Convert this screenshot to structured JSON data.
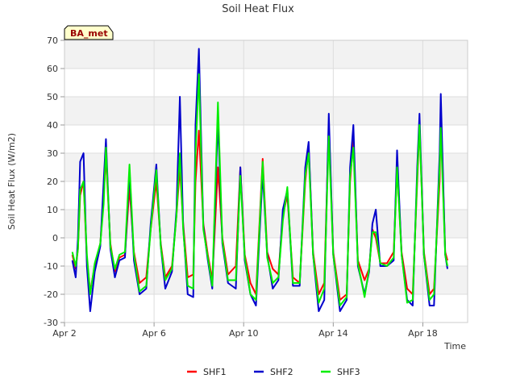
{
  "chart_data": {
    "type": "line",
    "title": "Soil Heat Flux",
    "badge": "BA_met",
    "xlabel": "Time",
    "ylabel": "Soil Heat Flux (W/m2)",
    "ylim": [
      -30,
      70
    ],
    "yticks": [
      -30,
      -20,
      -10,
      0,
      10,
      20,
      30,
      40,
      50,
      60,
      70
    ],
    "xlim": [
      2.0,
      20.0
    ],
    "xticks": [
      {
        "value": 2,
        "label": "Apr 2"
      },
      {
        "value": 6,
        "label": "Apr 6"
      },
      {
        "value": 10,
        "label": "Apr 10"
      },
      {
        "value": 14,
        "label": "Apr 14"
      },
      {
        "value": 18,
        "label": "Apr 18"
      }
    ],
    "grid": true,
    "legend_position": "bottom-center",
    "colors": {
      "SHF1": "#ff0000",
      "SHF2": "#0000cc",
      "SHF3": "#00ee00"
    },
    "series": [
      {
        "name": "SHF1",
        "color": "#ff0000",
        "points": [
          [
            2.35,
            -6
          ],
          [
            2.5,
            -11
          ],
          [
            2.6,
            -4
          ],
          [
            2.7,
            15
          ],
          [
            2.85,
            20
          ],
          [
            3.0,
            -8
          ],
          [
            3.15,
            -19
          ],
          [
            3.35,
            -10
          ],
          [
            3.6,
            -2
          ],
          [
            3.75,
            15
          ],
          [
            3.85,
            29
          ],
          [
            4.05,
            -2
          ],
          [
            4.25,
            -12
          ],
          [
            4.45,
            -7
          ],
          [
            4.7,
            -6
          ],
          [
            4.9,
            18
          ],
          [
            5.1,
            -5
          ],
          [
            5.35,
            -16
          ],
          [
            5.65,
            -14
          ],
          [
            5.85,
            3
          ],
          [
            6.1,
            20
          ],
          [
            6.3,
            -2
          ],
          [
            6.5,
            -14
          ],
          [
            6.8,
            -10
          ],
          [
            7.0,
            8
          ],
          [
            7.15,
            25
          ],
          [
            7.3,
            5
          ],
          [
            7.5,
            -14
          ],
          [
            7.75,
            -13
          ],
          [
            7.85,
            20
          ],
          [
            8.0,
            38
          ],
          [
            8.2,
            5
          ],
          [
            8.4,
            -6
          ],
          [
            8.6,
            -15
          ],
          [
            8.85,
            25
          ],
          [
            9.05,
            0
          ],
          [
            9.3,
            -13
          ],
          [
            9.65,
            -10
          ],
          [
            9.85,
            25
          ],
          [
            10.05,
            -6
          ],
          [
            10.3,
            -16
          ],
          [
            10.55,
            -20
          ],
          [
            10.85,
            28
          ],
          [
            11.05,
            -5
          ],
          [
            11.3,
            -11
          ],
          [
            11.55,
            -13
          ],
          [
            11.75,
            8
          ],
          [
            11.95,
            15
          ],
          [
            12.2,
            -14
          ],
          [
            12.5,
            -16
          ],
          [
            12.75,
            20
          ],
          [
            12.9,
            32
          ],
          [
            13.1,
            -5
          ],
          [
            13.35,
            -20
          ],
          [
            13.6,
            -16
          ],
          [
            13.8,
            40
          ],
          [
            14.0,
            -5
          ],
          [
            14.3,
            -22
          ],
          [
            14.6,
            -20
          ],
          [
            14.75,
            20
          ],
          [
            14.9,
            35
          ],
          [
            15.1,
            -8
          ],
          [
            15.4,
            -15
          ],
          [
            15.6,
            -11
          ],
          [
            15.75,
            3
          ],
          [
            15.9,
            0
          ],
          [
            16.1,
            -9
          ],
          [
            16.4,
            -9
          ],
          [
            16.7,
            -5
          ],
          [
            16.85,
            25
          ],
          [
            17.05,
            -5
          ],
          [
            17.3,
            -18
          ],
          [
            17.55,
            -20
          ],
          [
            17.75,
            20
          ],
          [
            17.85,
            40
          ],
          [
            18.05,
            -5
          ],
          [
            18.3,
            -20
          ],
          [
            18.5,
            -18
          ],
          [
            18.75,
            20
          ],
          [
            18.8,
            45
          ],
          [
            19.0,
            -5
          ],
          [
            19.1,
            -8
          ]
        ]
      },
      {
        "name": "SHF2",
        "color": "#0000cc",
        "points": [
          [
            2.35,
            -8
          ],
          [
            2.5,
            -14
          ],
          [
            2.6,
            0
          ],
          [
            2.7,
            27
          ],
          [
            2.85,
            30
          ],
          [
            3.0,
            -10
          ],
          [
            3.15,
            -26
          ],
          [
            3.35,
            -12
          ],
          [
            3.6,
            -3
          ],
          [
            3.75,
            20
          ],
          [
            3.85,
            35
          ],
          [
            4.05,
            -4
          ],
          [
            4.25,
            -14
          ],
          [
            4.45,
            -8
          ],
          [
            4.7,
            -7
          ],
          [
            4.9,
            24
          ],
          [
            5.1,
            -8
          ],
          [
            5.35,
            -20
          ],
          [
            5.65,
            -18
          ],
          [
            5.85,
            5
          ],
          [
            6.1,
            26
          ],
          [
            6.3,
            -3
          ],
          [
            6.5,
            -18
          ],
          [
            6.8,
            -12
          ],
          [
            7.0,
            10
          ],
          [
            7.15,
            50
          ],
          [
            7.3,
            4
          ],
          [
            7.5,
            -20
          ],
          [
            7.75,
            -21
          ],
          [
            7.85,
            40
          ],
          [
            8.0,
            67
          ],
          [
            8.2,
            4
          ],
          [
            8.4,
            -8
          ],
          [
            8.6,
            -18
          ],
          [
            8.85,
            42
          ],
          [
            9.05,
            -2
          ],
          [
            9.3,
            -16
          ],
          [
            9.65,
            -18
          ],
          [
            9.85,
            25
          ],
          [
            10.05,
            -8
          ],
          [
            10.3,
            -20
          ],
          [
            10.55,
            -24
          ],
          [
            10.85,
            23
          ],
          [
            11.05,
            -6
          ],
          [
            11.3,
            -18
          ],
          [
            11.55,
            -15
          ],
          [
            11.75,
            10
          ],
          [
            11.95,
            17
          ],
          [
            12.2,
            -17
          ],
          [
            12.5,
            -17
          ],
          [
            12.75,
            25
          ],
          [
            12.9,
            34
          ],
          [
            13.1,
            -6
          ],
          [
            13.35,
            -26
          ],
          [
            13.6,
            -22
          ],
          [
            13.8,
            44
          ],
          [
            14.0,
            -6
          ],
          [
            14.3,
            -26
          ],
          [
            14.6,
            -22
          ],
          [
            14.75,
            25
          ],
          [
            14.9,
            40
          ],
          [
            15.1,
            -10
          ],
          [
            15.4,
            -20
          ],
          [
            15.6,
            -12
          ],
          [
            15.75,
            5
          ],
          [
            15.9,
            10
          ],
          [
            16.1,
            -10
          ],
          [
            16.4,
            -10
          ],
          [
            16.7,
            -8
          ],
          [
            16.85,
            31
          ],
          [
            17.05,
            -6
          ],
          [
            17.3,
            -22
          ],
          [
            17.55,
            -24
          ],
          [
            17.75,
            25
          ],
          [
            17.85,
            44
          ],
          [
            18.05,
            -6
          ],
          [
            18.3,
            -24
          ],
          [
            18.5,
            -24
          ],
          [
            18.75,
            30
          ],
          [
            18.8,
            51
          ],
          [
            19.0,
            -6
          ],
          [
            19.1,
            -11
          ]
        ]
      },
      {
        "name": "SHF3",
        "color": "#00ee00",
        "points": [
          [
            2.35,
            -5
          ],
          [
            2.5,
            -10
          ],
          [
            2.6,
            -4
          ],
          [
            2.7,
            17
          ],
          [
            2.85,
            20
          ],
          [
            3.0,
            -6
          ],
          [
            3.15,
            -20
          ],
          [
            3.35,
            -9
          ],
          [
            3.6,
            -2
          ],
          [
            3.75,
            12
          ],
          [
            3.85,
            32
          ],
          [
            4.05,
            -3
          ],
          [
            4.25,
            -11
          ],
          [
            4.45,
            -6
          ],
          [
            4.7,
            -5
          ],
          [
            4.9,
            26
          ],
          [
            5.1,
            -6
          ],
          [
            5.35,
            -19
          ],
          [
            5.65,
            -17
          ],
          [
            5.85,
            3
          ],
          [
            6.1,
            24
          ],
          [
            6.3,
            -3
          ],
          [
            6.5,
            -15
          ],
          [
            6.8,
            -11
          ],
          [
            7.0,
            8
          ],
          [
            7.15,
            30
          ],
          [
            7.3,
            3
          ],
          [
            7.5,
            -17
          ],
          [
            7.75,
            -18
          ],
          [
            7.85,
            30
          ],
          [
            8.0,
            58
          ],
          [
            8.2,
            3
          ],
          [
            8.4,
            -7
          ],
          [
            8.6,
            -17
          ],
          [
            8.85,
            48
          ],
          [
            9.05,
            -1
          ],
          [
            9.3,
            -15
          ],
          [
            9.65,
            -15
          ],
          [
            9.85,
            22
          ],
          [
            10.05,
            -7
          ],
          [
            10.3,
            -20
          ],
          [
            10.55,
            -22
          ],
          [
            10.85,
            27
          ],
          [
            11.05,
            -7
          ],
          [
            11.3,
            -16
          ],
          [
            11.55,
            -14
          ],
          [
            11.75,
            6
          ],
          [
            11.95,
            18
          ],
          [
            12.2,
            -16
          ],
          [
            12.5,
            -16
          ],
          [
            12.75,
            22
          ],
          [
            12.9,
            30
          ],
          [
            13.1,
            -6
          ],
          [
            13.35,
            -23
          ],
          [
            13.6,
            -18
          ],
          [
            13.8,
            36
          ],
          [
            14.0,
            -6
          ],
          [
            14.3,
            -24
          ],
          [
            14.6,
            -21
          ],
          [
            14.75,
            22
          ],
          [
            14.9,
            32
          ],
          [
            15.1,
            -9
          ],
          [
            15.4,
            -21
          ],
          [
            15.6,
            -11
          ],
          [
            15.75,
            2
          ],
          [
            15.9,
            2
          ],
          [
            16.1,
            -9
          ],
          [
            16.4,
            -10
          ],
          [
            16.7,
            -7
          ],
          [
            16.85,
            25
          ],
          [
            17.05,
            -6
          ],
          [
            17.3,
            -23
          ],
          [
            17.55,
            -22
          ],
          [
            17.75,
            22
          ],
          [
            17.85,
            40
          ],
          [
            18.05,
            -6
          ],
          [
            18.3,
            -22
          ],
          [
            18.5,
            -20
          ],
          [
            18.75,
            25
          ],
          [
            18.8,
            39
          ],
          [
            19.0,
            -6
          ],
          [
            19.1,
            -10
          ]
        ]
      }
    ]
  }
}
